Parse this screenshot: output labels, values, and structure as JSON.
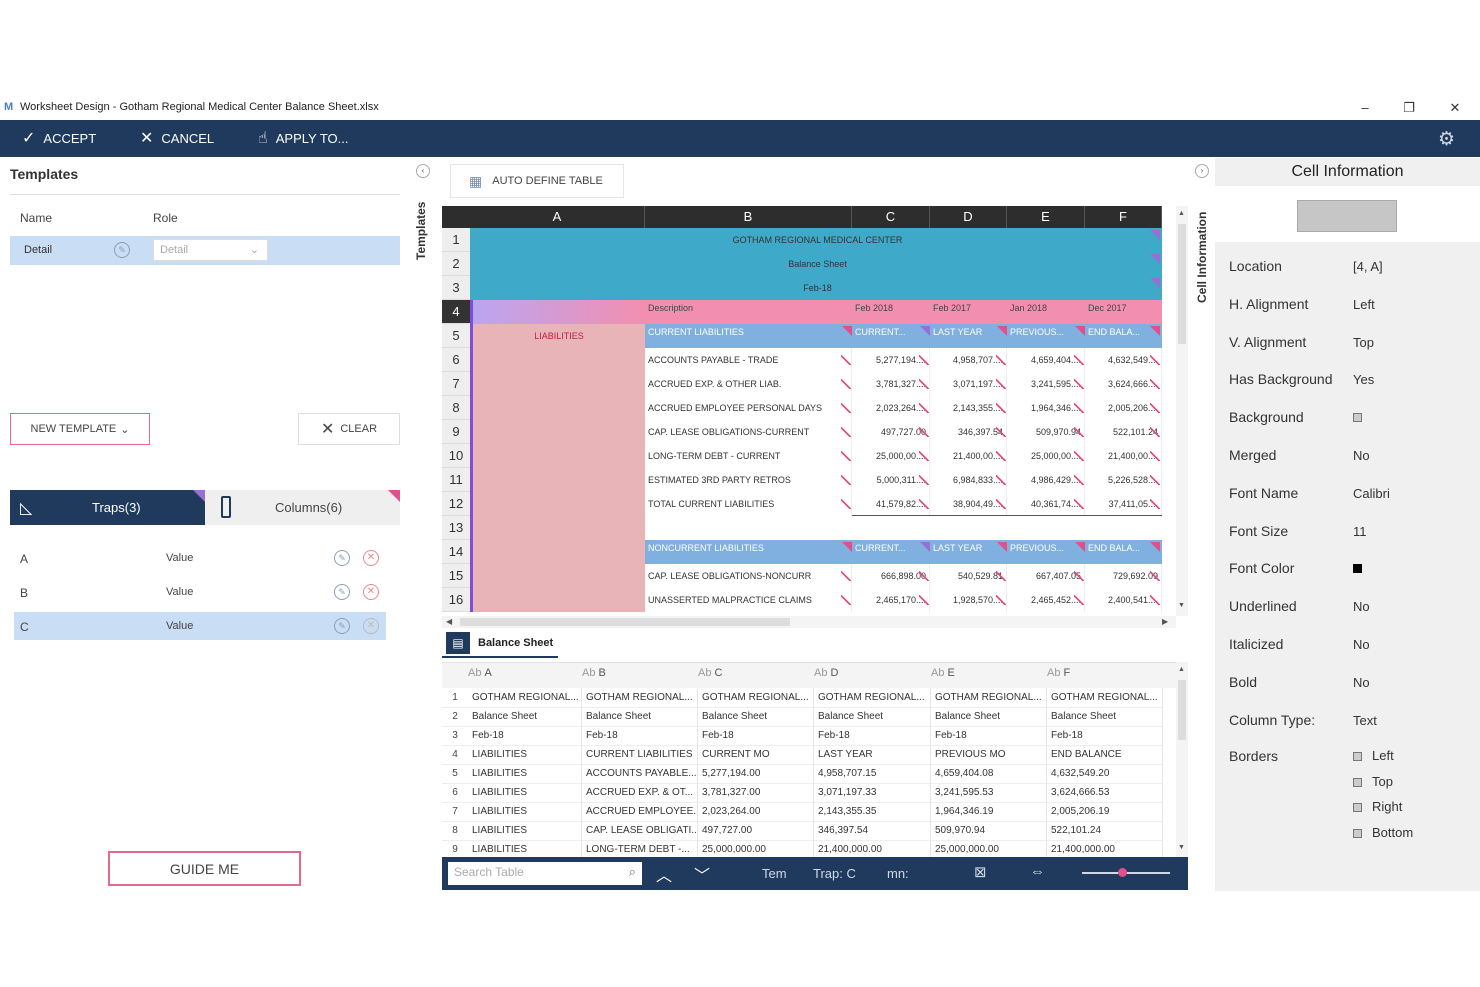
{
  "window": {
    "title": "Worksheet Design - Gotham Regional Medical Center Balance Sheet.xlsx",
    "logo": "M",
    "minimize": "–",
    "restore": "❐",
    "close": "✕"
  },
  "toolbar": {
    "accept": "ACCEPT",
    "cancel": "CANCEL",
    "apply_to": "APPLY TO...",
    "settings_icon": "gear-icon"
  },
  "templates": {
    "title": "Templates",
    "col_name": "Name",
    "col_role": "Role",
    "row": {
      "name": "Detail",
      "role": "Detail"
    },
    "new_template": "NEW TEMPLATE",
    "clear": "CLEAR"
  },
  "traps_tab": {
    "label": "Traps(3)"
  },
  "columns_tab": {
    "label": "Columns(6)"
  },
  "traps": [
    {
      "col": "A",
      "type": "Value"
    },
    {
      "col": "B",
      "type": "Value"
    },
    {
      "col": "C",
      "type": "Value"
    }
  ],
  "guide_me": "GUIDE ME",
  "side_labels": {
    "templates": "Templates",
    "cell_information": "Cell Information"
  },
  "grid": {
    "auto_define": "AUTO DEFINE TABLE",
    "columns": [
      "A",
      "B",
      "C",
      "D",
      "E",
      "F"
    ],
    "rows": [
      "1",
      "2",
      "3",
      "4",
      "5",
      "6",
      "7",
      "8",
      "9",
      "10",
      "11",
      "12",
      "13",
      "14",
      "15",
      "16"
    ],
    "title1": "GOTHAM REGIONAL MEDICAL CENTER",
    "title2": "Balance Sheet",
    "title3": "Feb-18",
    "header_row": [
      "Description",
      "Feb 2018",
      "Feb 2017",
      "Jan 2018",
      "Dec 2017"
    ],
    "liabilities": "LIABILITIES",
    "current_row": [
      "CURRENT LIABILITIES",
      "CURRENT...",
      "LAST YEAR",
      "PREVIOUS...",
      "END BALA..."
    ],
    "data_rows": [
      [
        "ACCOUNTS PAYABLE - TRADE",
        "5,277,194....",
        "4,958,707....",
        "4,659,404....",
        "4,632,549...."
      ],
      [
        "ACCRUED EXP. & OTHER LIAB.",
        "3,781,327....",
        "3,071,197....",
        "3,241,595....",
        "3,624,666...."
      ],
      [
        "ACCRUED EMPLOYEE PERSONAL DAYS",
        "2,023,264....",
        "2,143,355....",
        "1,964,346....",
        "2,005,206...."
      ],
      [
        "CAP. LEASE OBLIGATIONS-CURRENT",
        "497,727.00",
        "346,397.54",
        "509,970.94",
        "522,101.24"
      ],
      [
        "LONG-TERM DEBT - CURRENT",
        "25,000,00....",
        "21,400,00....",
        "25,000,00....",
        "21,400,00...."
      ],
      [
        "ESTIMATED 3RD PARTY RETROS",
        "5,000,311....",
        "6,984,833....",
        "4,986,429....",
        "5,226,528...."
      ],
      [
        "TOTAL CURRENT LIABILITIES",
        "41,579,82....",
        "38,904,49....",
        "40,361,74....",
        "37,411,05...."
      ]
    ],
    "noncurrent_row": [
      "NONCURRENT LIABILITIES",
      "CURRENT...",
      "LAST YEAR",
      "PREVIOUS...",
      "END BALA..."
    ],
    "nc_rows": [
      [
        "CAP. LEASE OBLIGATIONS-NONCURR",
        "666,898.00",
        "540,529.81",
        "667,407.05",
        "729,692.09"
      ],
      [
        "UNASSERTED MALPRACTICE CLAIMS",
        "2,465,170....",
        "1,928,570....",
        "2,465,452....",
        "2,400,541...."
      ]
    ],
    "sheet_tab": "Balance Sheet"
  },
  "data_table": {
    "headers": [
      "A",
      "B",
      "C",
      "D",
      "E",
      "F"
    ],
    "type_prefix": "Ab",
    "rows": [
      [
        "1",
        "GOTHAM REGIONAL...",
        "GOTHAM REGIONAL...",
        "GOTHAM REGIONAL...",
        "GOTHAM REGIONAL...",
        "GOTHAM REGIONAL...",
        "GOTHAM REGIONAL..."
      ],
      [
        "2",
        "Balance Sheet",
        "Balance Sheet",
        "Balance Sheet",
        "Balance Sheet",
        "Balance Sheet",
        "Balance Sheet"
      ],
      [
        "3",
        "Feb-18",
        "Feb-18",
        "Feb-18",
        "Feb-18",
        "Feb-18",
        "Feb-18"
      ],
      [
        "4",
        "LIABILITIES",
        "CURRENT LIABILITIES",
        "CURRENT MO",
        "LAST YEAR",
        "PREVIOUS MO",
        "END BALANCE"
      ],
      [
        "5",
        "LIABILITIES",
        "ACCOUNTS PAYABLE...",
        "5,277,194.00",
        "4,958,707.15",
        "4,659,404.08",
        "4,632,549.20"
      ],
      [
        "6",
        "LIABILITIES",
        "ACCRUED EXP. & OT...",
        "3,781,327.00",
        "3,071,197.33",
        "3,241,595.53",
        "3,624,666.53"
      ],
      [
        "7",
        "LIABILITIES",
        "ACCRUED EMPLOYEE...",
        "2,023,264.00",
        "2,143,355.35",
        "1,964,346.19",
        "2,005,206.19"
      ],
      [
        "8",
        "LIABILITIES",
        "CAP. LEASE OBLIGATI...",
        "497,727.00",
        "346,397.54",
        "509,970.94",
        "522,101.24"
      ],
      [
        "9",
        "LIABILITIES",
        "LONG-TERM DEBT -...",
        "25,000,000.00",
        "21,400,000.00",
        "25,000,000.00",
        "21,400,000.00"
      ]
    ],
    "search_placeholder": "Search Table",
    "status_template": "Tem",
    "status_trap": "Trap: C",
    "status_column": "mn:"
  },
  "cell_info": {
    "title": "Cell Information",
    "props": [
      {
        "label": "Location",
        "value": "[4, A]"
      },
      {
        "label": "H. Alignment",
        "value": "Left"
      },
      {
        "label": "V. Alignment",
        "value": "Top"
      },
      {
        "label": "Has Background",
        "value": "Yes"
      },
      {
        "label": "Background",
        "value": ""
      },
      {
        "label": "Merged",
        "value": "No"
      },
      {
        "label": "Font Name",
        "value": "Calibri"
      },
      {
        "label": "Font Size",
        "value": "11"
      },
      {
        "label": "Font Color",
        "value": ""
      },
      {
        "label": "Underlined",
        "value": "No"
      },
      {
        "label": "Italicized",
        "value": "No"
      },
      {
        "label": "Bold",
        "value": "No"
      },
      {
        "label": "Column Type:",
        "value": "Text"
      }
    ],
    "borders_label": "Borders",
    "borders": [
      "Left",
      "Top",
      "Right",
      "Bottom"
    ]
  },
  "colors": {
    "toolbar": "#1f3a5c",
    "title_fill": "#3fa9c9",
    "header_pink": "#f28fb0",
    "section_blue": "#7fb0e0",
    "col_a_fill": "#e8b4b8",
    "selected_row": "#c9ddf5",
    "accent_pink": "#e0508a"
  }
}
